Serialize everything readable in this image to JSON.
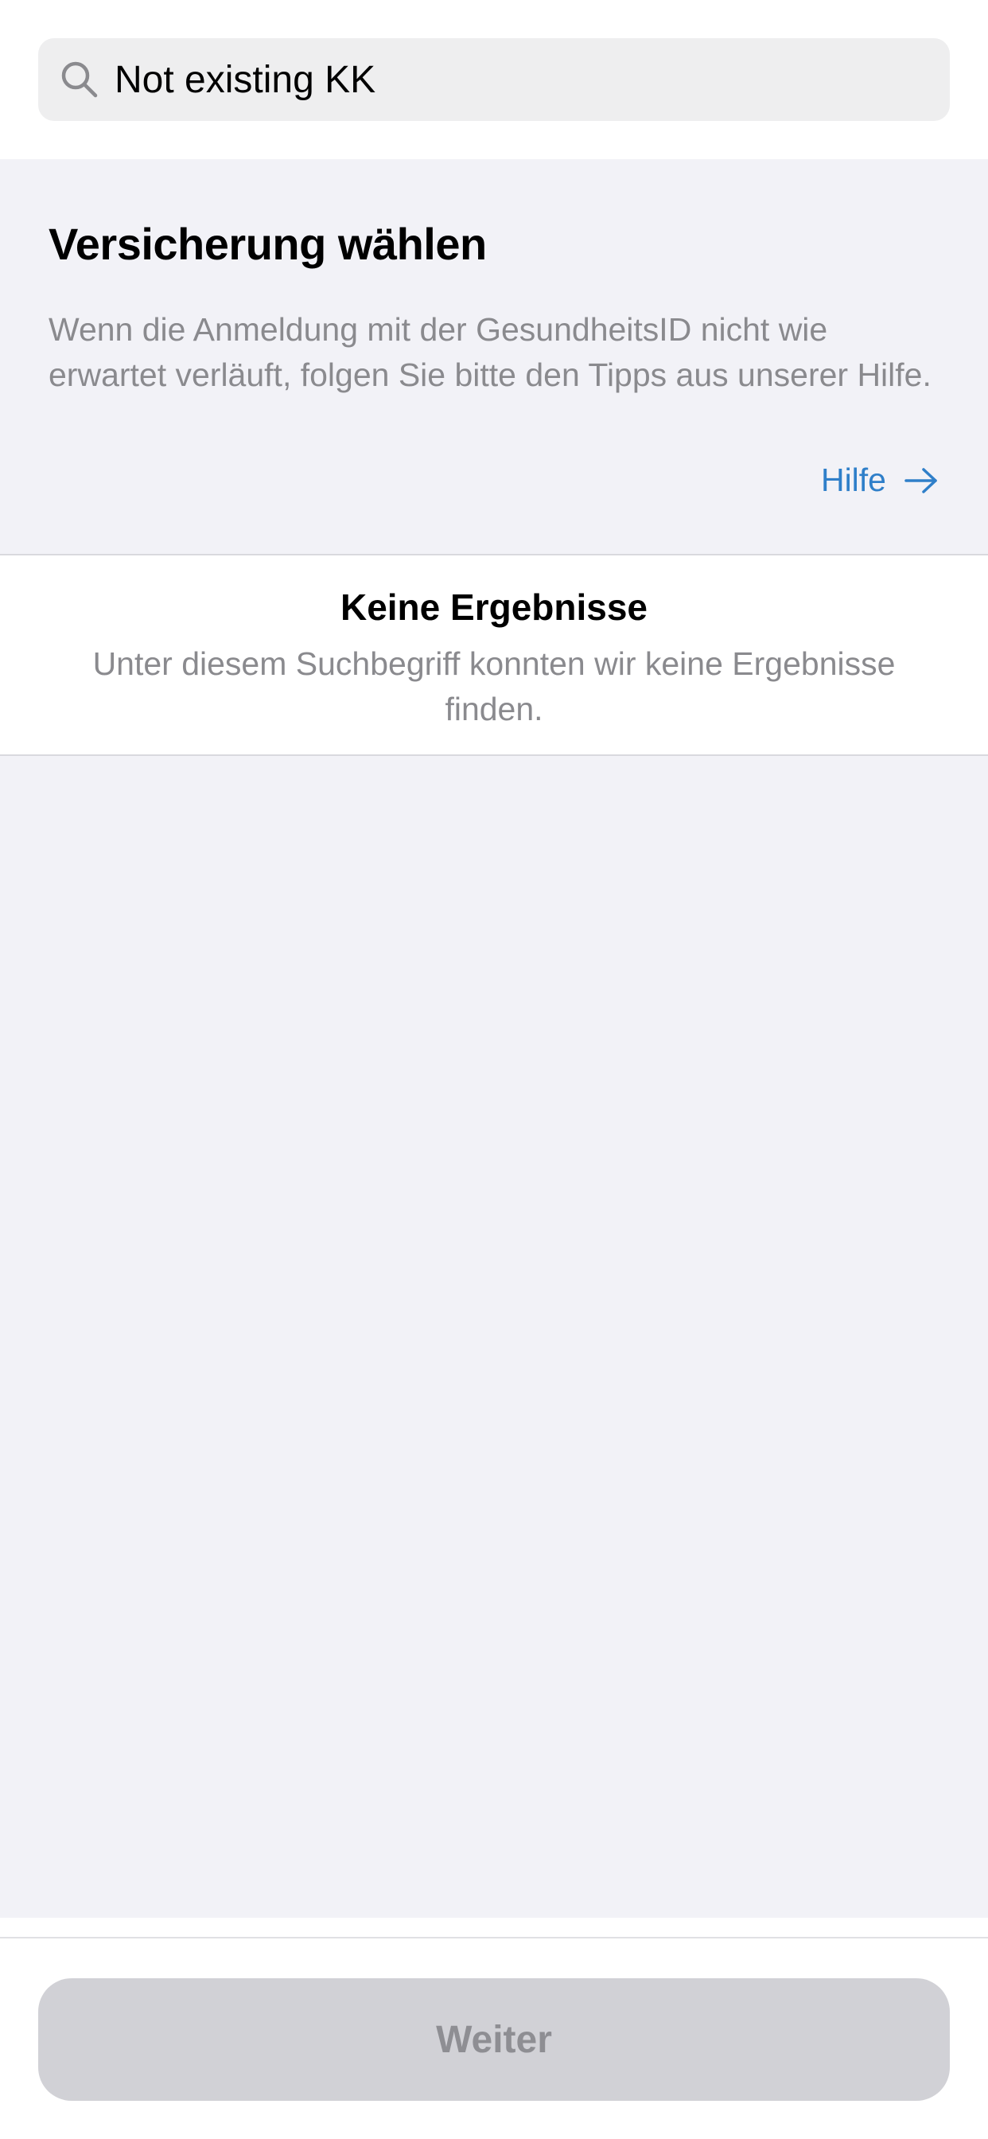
{
  "search": {
    "value": "Not existing KK",
    "icon": "search-icon"
  },
  "header": {
    "title": "Versicherung wählen",
    "description": "Wenn die Anmeldung mit der GesundheitsID nicht wie erwartet verläuft, folgen Sie bitte den Tipps aus unserer Hilfe.",
    "help_label": "Hilfe",
    "help_icon": "arrow-right-icon"
  },
  "empty_state": {
    "title": "Keine Ergebnisse",
    "text": "Unter diesem Suchbegriff konnten wir keine Ergebnisse finden."
  },
  "footer": {
    "continue_label": "Weiter",
    "continue_enabled": false
  },
  "colors": {
    "background_grouped": "#f2f2f7",
    "link_accent": "#2f7fc9",
    "secondary_text": "#8a8a8e",
    "disabled_button": "#d1d1d6"
  }
}
